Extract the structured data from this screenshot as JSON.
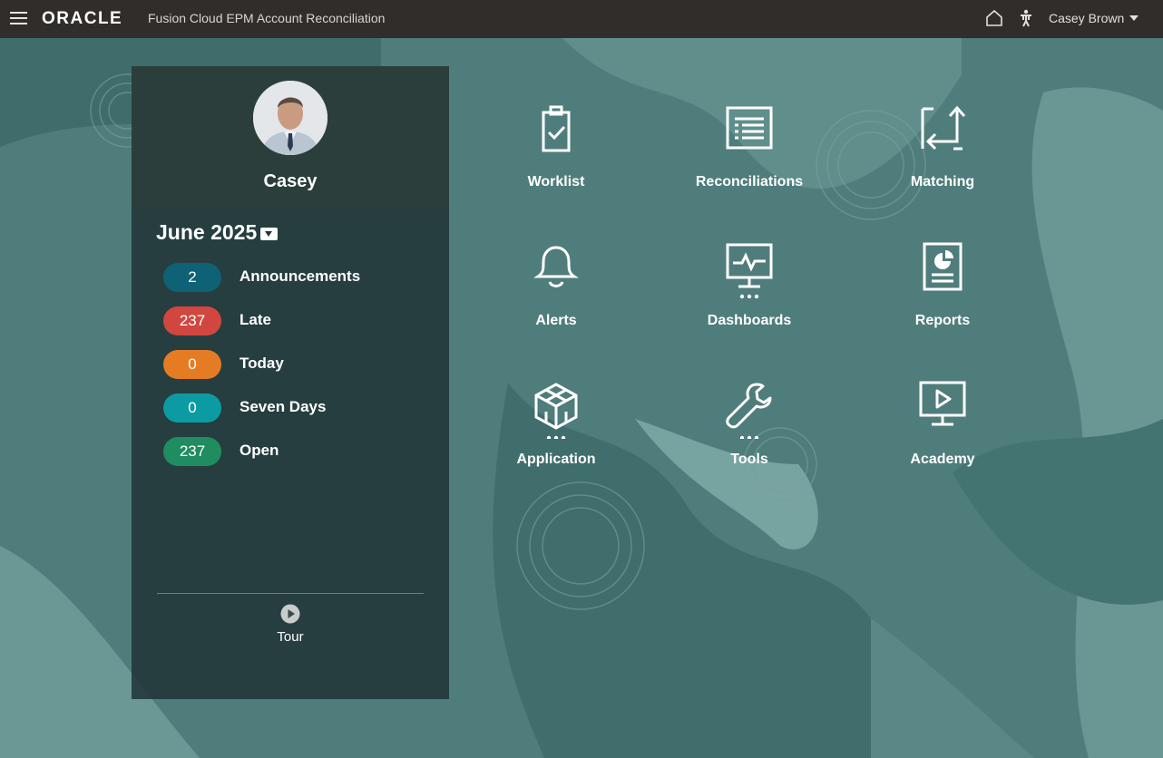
{
  "header": {
    "logo_text": "ORACLE",
    "app_title": "Fusion Cloud EPM Account Reconciliation",
    "user_name": "Casey Brown",
    "icons": [
      "menu-icon",
      "home-icon",
      "accessibility-icon",
      "chevron-down-icon"
    ]
  },
  "profile": {
    "name": "Casey",
    "period": "June 2025",
    "stats": [
      {
        "value": "2",
        "label": "Announcements",
        "color": "#0f6175"
      },
      {
        "value": "237",
        "label": "Late",
        "color": "#d1473f"
      },
      {
        "value": "0",
        "label": "Today",
        "color": "#e57c24"
      },
      {
        "value": "0",
        "label": "Seven Days",
        "color": "#0d9ba3"
      },
      {
        "value": "237",
        "label": "Open",
        "color": "#1f8d5f"
      }
    ],
    "tour_label": "Tour"
  },
  "launcher": {
    "tiles": [
      {
        "label": "Worklist",
        "icon": "clipboard-check-icon"
      },
      {
        "label": "Reconciliations",
        "icon": "list-document-icon"
      },
      {
        "label": "Matching",
        "icon": "matching-arrows-icon"
      },
      {
        "label": "Alerts",
        "icon": "bell-icon"
      },
      {
        "label": "Dashboards",
        "icon": "monitor-chart-icon"
      },
      {
        "label": "Reports",
        "icon": "report-pie-icon"
      },
      {
        "label": "Application",
        "icon": "cube-icon"
      },
      {
        "label": "Tools",
        "icon": "wrench-icon"
      },
      {
        "label": "Academy",
        "icon": "video-play-icon"
      }
    ]
  },
  "colors": {
    "topbar": "#312d2a",
    "background": "#4e7d7b",
    "panel": "#213638"
  }
}
